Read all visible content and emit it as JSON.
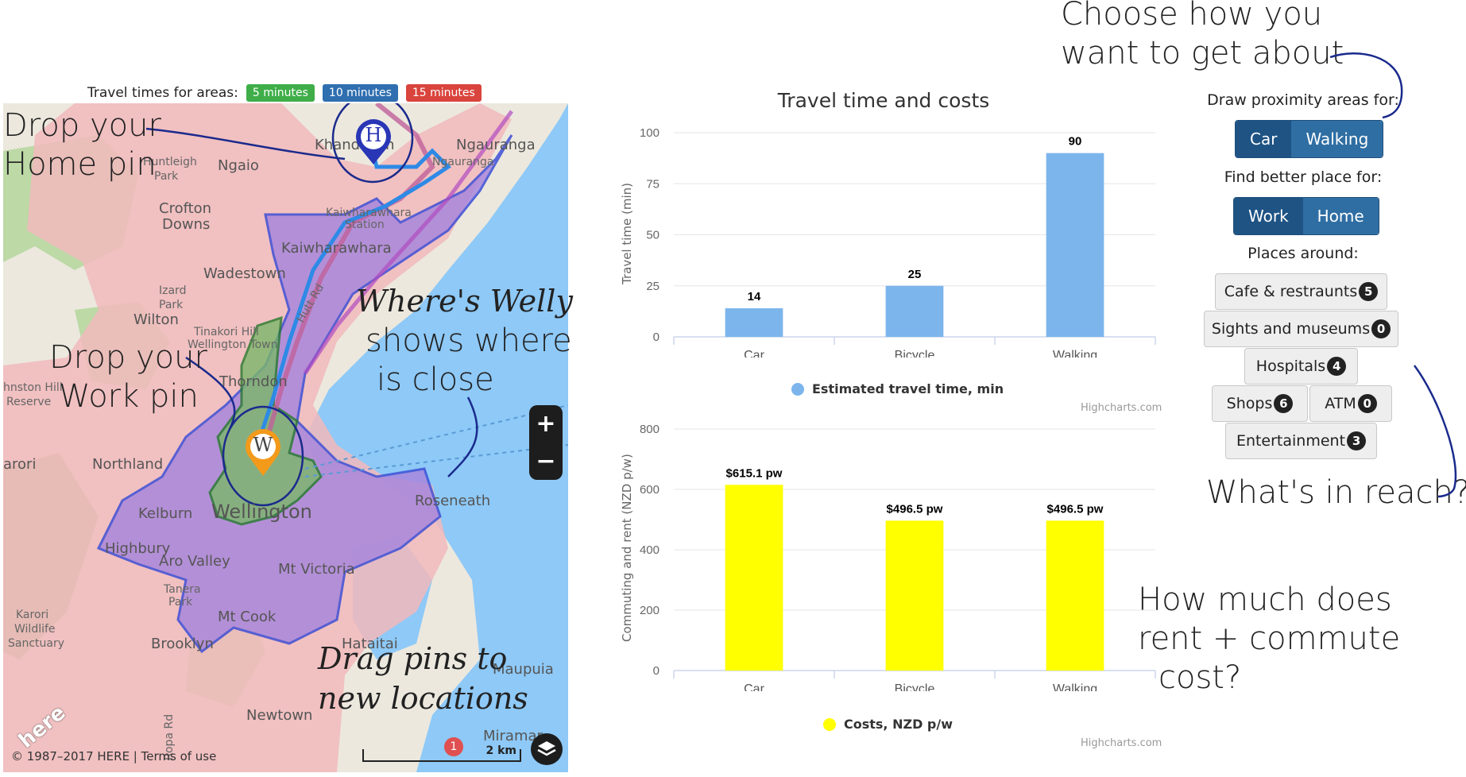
{
  "legend": {
    "label": "Travel times for areas:",
    "items": [
      {
        "label": "5 minutes",
        "color": "#3fae49"
      },
      {
        "label": "10 minutes",
        "color": "#2f6fb0"
      },
      {
        "label": "15 minutes",
        "color": "#d9443c"
      }
    ]
  },
  "map": {
    "places": {
      "khandallah": "Khandallah",
      "ngauranga": "Ngauranga",
      "ngauranga2": "Ngauranga",
      "ngaio": "Ngaio",
      "huntleigh": "Huntleigh",
      "park": "Park",
      "crofton": "Crofton",
      "downs": "Downs",
      "kaiwharawhara_station": "Kaiwharawhara",
      "station": "Station",
      "kaiwharawhara": "Kaiwharawhara",
      "wadestown": "Wadestown",
      "izard": "Izard",
      "park2": "Park",
      "wilton": "Wilton",
      "tinakori": "Tinakori Hill",
      "wellington_town": "Wellington Town",
      "thorndon": "Thorndon",
      "northland": "Northland",
      "kelburn": "Kelburn",
      "wellington": "Wellington",
      "highbury": "Highbury",
      "aro_valley": "Aro Valley",
      "mt_victoria": "Mt Victoria",
      "roseneath": "Roseneath",
      "tanera": "Tanera",
      "park3": "Park",
      "mt_cook": "Mt Cook",
      "karori": "Karori",
      "wildlife": "Wildlife",
      "sanctuary": "Sanctuary",
      "brooklyn": "Brooklyn",
      "hataitai": "Hataitai",
      "maupuia": "Maupuia",
      "newtown": "Newtown",
      "miramar": "Miramar",
      "johnston": "hnston Hill",
      "reserve": "Reserve",
      "karori_left": "arori",
      "hutt_rd": "Hutt Rd",
      "ropa_rd": "Ropa Rd"
    },
    "zoom_in": "+",
    "zoom_out": "−",
    "copyright": "© 1987–2017 HERE | Terms of use",
    "scale": "2 km",
    "logo": "here",
    "home_pin": "H",
    "work_pin": "W",
    "route_badge": "1",
    "colors": {
      "water": "#8ec9f7",
      "land": "#ece8de",
      "fifteen": "#f2b9bc",
      "ten": "#b28be0",
      "five": "#7bb86a"
    }
  },
  "annotations": {
    "home_1": "Drop your",
    "home_2": "Home pin",
    "work_1": "Drop your",
    "work_2": "Work pin",
    "welly_1": "Where's Welly",
    "welly_2": "shows where",
    "welly_3": "is close",
    "drag_1": "Drag pins to",
    "drag_2": "new locations",
    "choose_1": "Choose how you",
    "choose_2": "want to get about",
    "reach": "What's in reach?",
    "cost_1": "How much does",
    "cost_2": "rent + commute",
    "cost_3": "cost?"
  },
  "controls": {
    "draw_label": "Draw proximity areas for:",
    "modes": [
      "Car",
      "Walking"
    ],
    "find_label": "Find better place for:",
    "targets": [
      "Work",
      "Home"
    ],
    "places_label": "Places around:",
    "places": [
      {
        "label": "Cafe & restraunts",
        "count": "5"
      },
      {
        "label": "Sights and museums",
        "count": "0"
      },
      {
        "label": "Hospitals",
        "count": "4"
      },
      {
        "label": "Shops",
        "count": "6"
      },
      {
        "label": "ATM",
        "count": "0"
      },
      {
        "label": "Entertainment",
        "count": "3"
      }
    ]
  },
  "chart_data": [
    {
      "type": "bar",
      "title": "Travel time and costs",
      "categories": [
        "Car",
        "Bicycle",
        "Walking"
      ],
      "series": [
        {
          "name": "Estimated travel time, min",
          "values": [
            14,
            25,
            90
          ],
          "color": "#7cb5ec"
        }
      ],
      "value_labels": [
        "14",
        "25",
        "90"
      ],
      "ylabel": "Travel time (min)",
      "ylim": [
        0,
        100
      ],
      "yticks": [
        "0",
        "25",
        "50",
        "75",
        "100"
      ],
      "credits": "Highcharts.com",
      "grid": true,
      "legend": "bottom-center"
    },
    {
      "type": "bar",
      "categories": [
        "Car",
        "Bicycle",
        "Walking"
      ],
      "series": [
        {
          "name": "Costs, NZD p/w",
          "values": [
            615.1,
            496.5,
            496.5
          ],
          "color": "#ffff00"
        }
      ],
      "value_labels": [
        "$615.1 pw",
        "$496.5 pw",
        "$496.5 pw"
      ],
      "ylabel": "Commuting and rent (NZD p/w)",
      "ylim": [
        0,
        800
      ],
      "yticks": [
        "0",
        "200",
        "400",
        "600",
        "800"
      ],
      "credits": "Highcharts.com",
      "grid": true,
      "legend": "bottom-center"
    }
  ]
}
